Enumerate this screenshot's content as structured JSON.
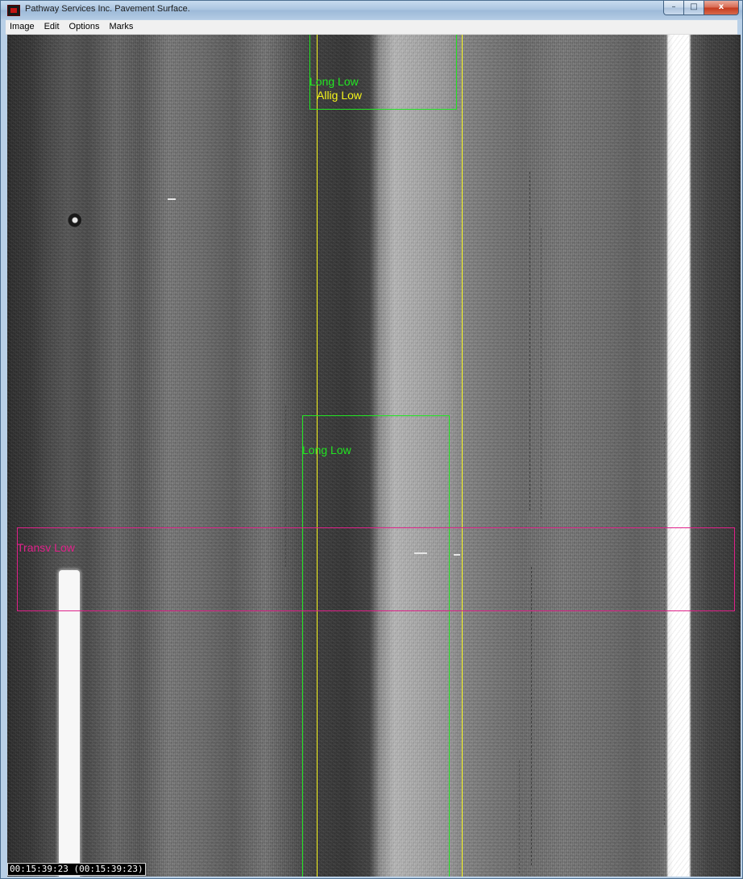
{
  "window": {
    "title": "Pathway Services Inc. Pavement Surface.",
    "caption": {
      "minimize": "–",
      "maximize": "□",
      "close": "x"
    }
  },
  "menu": {
    "items": [
      "Image",
      "Edit",
      "Options",
      "Marks"
    ]
  },
  "marks": [
    {
      "id": "top-box",
      "color": "#22e622",
      "labels": [
        "Long Low",
        "Allig Low"
      ],
      "label_colors": [
        "#22e622",
        "#f5f51a"
      ]
    },
    {
      "id": "middle-box",
      "color": "#22e622",
      "labels": [
        "Long Low"
      ],
      "label_colors": [
        "#22e622"
      ]
    },
    {
      "id": "transverse-box",
      "color": "#e0218a",
      "labels": [
        "Transv Low"
      ],
      "label_colors": [
        "#e0218a"
      ]
    }
  ],
  "guide_line_color": "#f5f51a",
  "status": {
    "timecode": "00:15:39:23 (00:15:39:23)"
  }
}
